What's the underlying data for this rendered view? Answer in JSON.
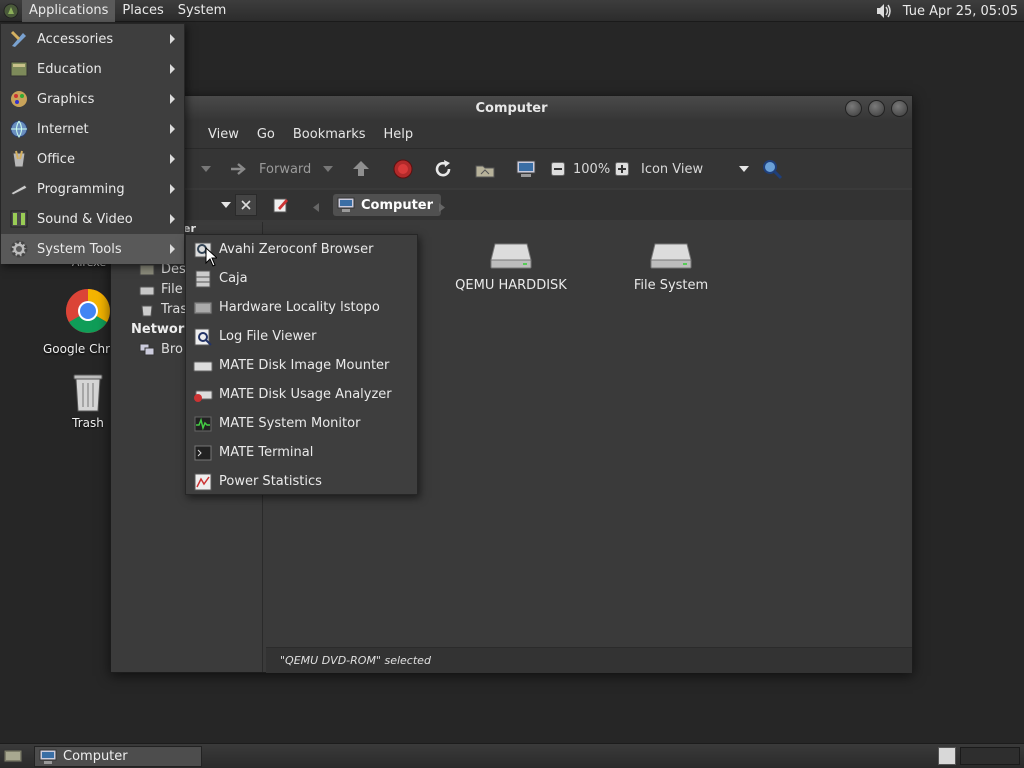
{
  "top_panel": {
    "menus": [
      "Applications",
      "Places",
      "System"
    ],
    "clock": "Tue Apr 25, 05:05"
  },
  "desktop": {
    "icons": [
      {
        "label": "Airexe",
        "icon": "folder-icon"
      },
      {
        "label": "Google Chrome",
        "icon": "chrome-icon"
      },
      {
        "label": "Trash",
        "icon": "trash-icon"
      }
    ]
  },
  "window": {
    "title": "Computer",
    "menubar": [
      "View",
      "Go",
      "Bookmarks",
      "Help"
    ],
    "toolbar": {
      "forward_label": "Forward",
      "zoom_level": "100%",
      "view_mode": "Icon View"
    },
    "breadcrumb": "Computer",
    "sidebar": {
      "section_places_partial": "er",
      "items": [
        "Des",
        "File",
        "Tras"
      ],
      "section_network": "Network",
      "network_items": [
        "Bro"
      ]
    },
    "drives": [
      {
        "label": "QEMU HARDDISK"
      },
      {
        "label": "File System"
      }
    ],
    "status": "\"QEMU DVD-ROM\" selected"
  },
  "main_menu": {
    "items": [
      {
        "label": "Accessories",
        "icon": "accessories-icon"
      },
      {
        "label": "Education",
        "icon": "education-icon"
      },
      {
        "label": "Graphics",
        "icon": "graphics-icon"
      },
      {
        "label": "Internet",
        "icon": "internet-globe-icon"
      },
      {
        "label": "Office",
        "icon": "office-icon"
      },
      {
        "label": "Programming",
        "icon": "programming-icon"
      },
      {
        "label": "Sound & Video",
        "icon": "sound-video-icon"
      },
      {
        "label": "System Tools",
        "icon": "gear-icon"
      }
    ],
    "active_index": 7
  },
  "submenu": {
    "items": [
      {
        "label": "Avahi Zeroconf Browser"
      },
      {
        "label": "Caja"
      },
      {
        "label": "Hardware Locality lstopo"
      },
      {
        "label": "Log File Viewer"
      },
      {
        "label": "MATE Disk Image Mounter"
      },
      {
        "label": "MATE Disk Usage Analyzer"
      },
      {
        "label": "MATE System Monitor"
      },
      {
        "label": "MATE Terminal"
      },
      {
        "label": "Power Statistics"
      }
    ]
  },
  "bottom_panel": {
    "task_label": "Computer"
  },
  "colors": {
    "panel": "#333333",
    "menu_bg": "#3e3e3e",
    "menu_active": "#595959",
    "window_bg": "#3a3a3a"
  }
}
